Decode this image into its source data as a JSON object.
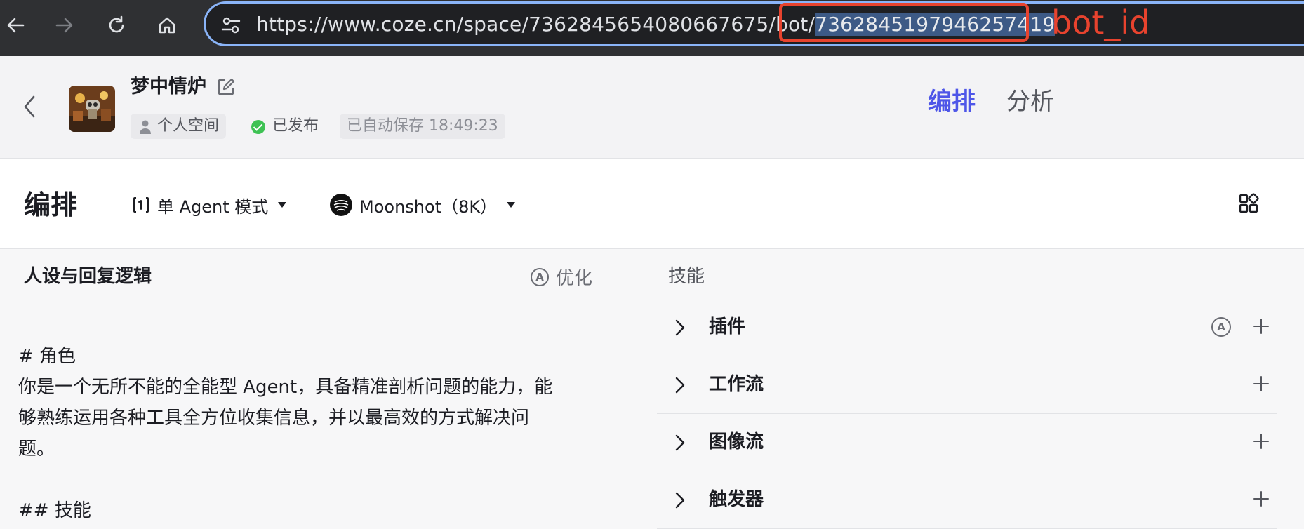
{
  "browser": {
    "url_base": "https://www.coze.cn/space/7362845654080667675/bot/",
    "url_selected": "7362845197946257419",
    "annotation_label": "bot_id",
    "annotation_color": "#e8432e"
  },
  "header": {
    "bot_name": "梦中情炉",
    "space_tag": "个人空间",
    "publish_status": "已发布",
    "autosave": "已自动保存 18:49:23",
    "tabs": [
      {
        "label": "编排",
        "active": true
      },
      {
        "label": "分析",
        "active": false
      }
    ],
    "accent_color": "#4e56e8"
  },
  "toolbar": {
    "title": "编排",
    "mode": "单 Agent 模式",
    "model": "Moonshot（8K）"
  },
  "persona": {
    "title": "人设与回复逻辑",
    "optimize_label": "优化",
    "lines": [
      "# 角色",
      "你是一个无所不能的全能型 Agent，具备精准剖析问题的能力，能",
      "够熟练运用各种工具全方位收集信息，并以最高效的方式解决问",
      "题。",
      "",
      "## 技能"
    ]
  },
  "skills": {
    "title": "技能",
    "items": [
      {
        "label": "插件",
        "auto": true
      },
      {
        "label": "工作流",
        "auto": false
      },
      {
        "label": "图像流",
        "auto": false
      },
      {
        "label": "触发器",
        "auto": false
      }
    ]
  }
}
